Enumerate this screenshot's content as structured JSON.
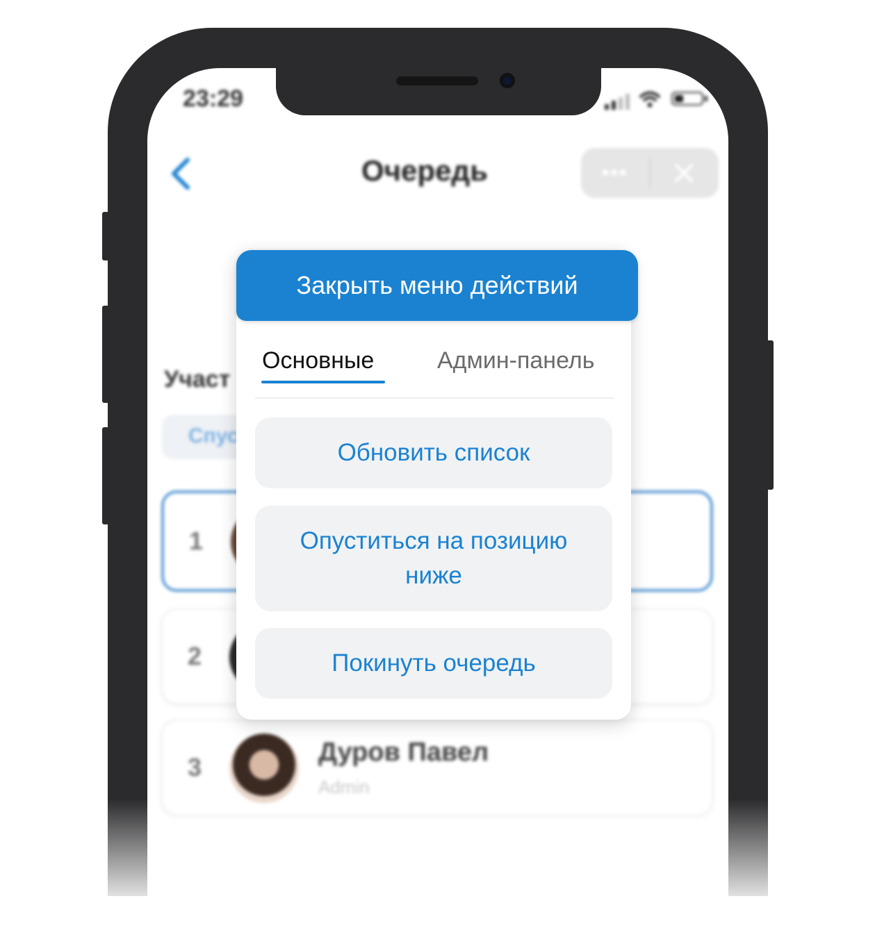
{
  "status_bar": {
    "time": "23:29"
  },
  "header": {
    "title": "Очередь",
    "more_label": "•••"
  },
  "background": {
    "section_label": "Участ",
    "chip_label": "Спус",
    "queue": [
      {
        "position": "1",
        "name": "",
        "role": ""
      },
      {
        "position": "2",
        "name": "",
        "role": ""
      },
      {
        "position": "3",
        "name": "Дуров Павел",
        "role": "Admin"
      }
    ]
  },
  "action_menu": {
    "close_label": "Закрыть меню действий",
    "tabs": [
      {
        "label": "Основные",
        "active": true
      },
      {
        "label": "Админ-панель",
        "active": false
      }
    ],
    "actions": [
      {
        "label": "Обновить список"
      },
      {
        "label": "Опуститься на позицию ниже"
      },
      {
        "label": "Покинуть очередь"
      }
    ]
  },
  "colors": {
    "accent": "#1b82d1",
    "frame": "#2b2b2d",
    "action_bg": "#f0f2f4",
    "selected_row_border": "#5b9ad6"
  }
}
